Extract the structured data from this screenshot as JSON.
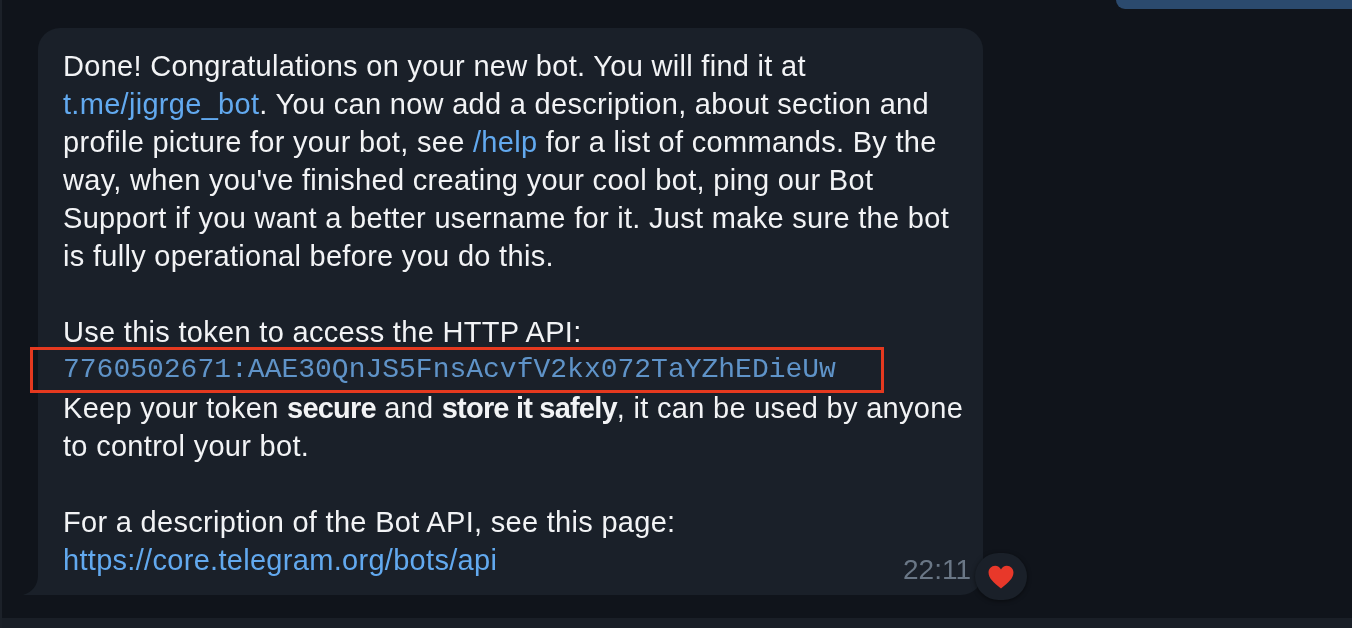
{
  "message": {
    "paragraphs": [
      {
        "lines": [
          {
            "kind": "text",
            "segments": [
              {
                "kind": "plain",
                "text": "Done! Congratulations on your new bot. You will find it at "
              },
              {
                "kind": "link",
                "text": "t.me/jigrge_bot"
              },
              {
                "kind": "plain",
                "text": ". You can now add a description, about section and profile picture for your bot, see "
              },
              {
                "kind": "link",
                "text": "/help"
              },
              {
                "kind": "plain",
                "text": " for a list of commands. By the way, when you've finished creating your cool bot, ping our Bot Support if you want a better username for it. Just make sure the bot is fully operational before you do this."
              }
            ]
          }
        ]
      },
      {
        "lines": [
          {
            "kind": "text",
            "segments": [
              {
                "kind": "plain",
                "text": "Use this token to access the HTTP API:"
              }
            ]
          },
          {
            "kind": "token",
            "text": "7760502671:AAE30QnJS5FnsAcvfV2kx072TaYZhEDieUw",
            "highlighted": true
          },
          {
            "kind": "text",
            "segments": [
              {
                "kind": "plain",
                "text": "Keep your token **secure** and **store it safely**, it can be used by anyone to control your bot."
              }
            ]
          }
        ]
      },
      {
        "lines": [
          {
            "kind": "text",
            "segments": [
              {
                "kind": "plain",
                "text": "For a description of the Bot API, see this page:"
              }
            ]
          },
          {
            "kind": "link",
            "text": "https://core.telegram.org/bots/api"
          }
        ]
      }
    ],
    "time": "22:11"
  }
}
